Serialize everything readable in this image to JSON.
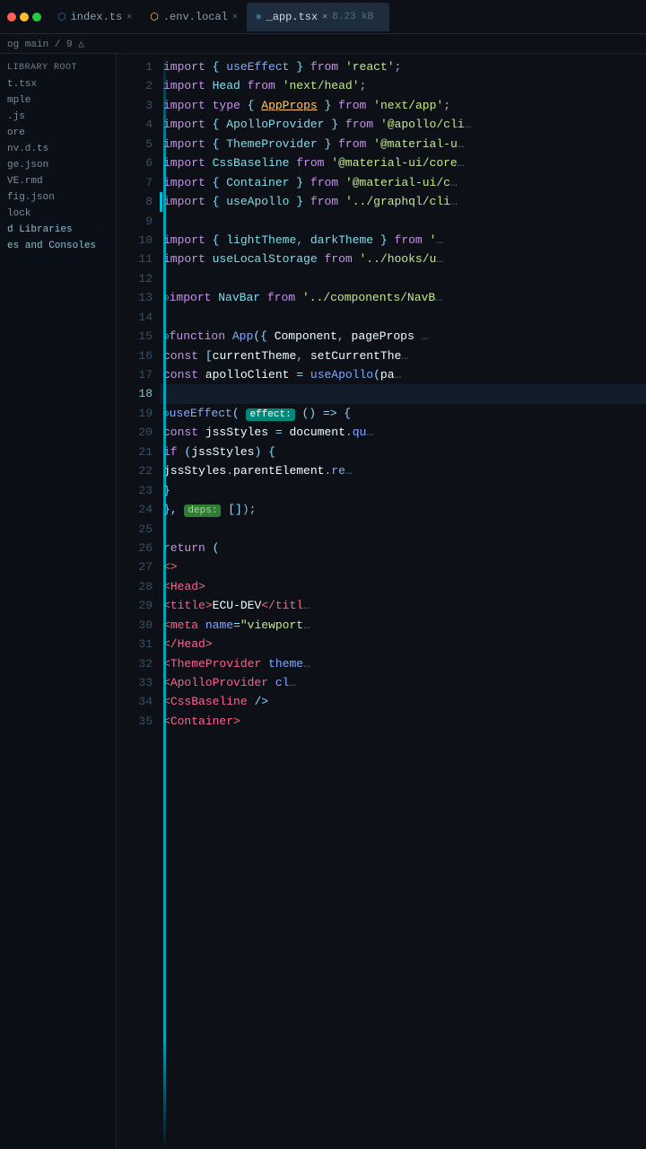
{
  "tabs": [
    {
      "label": "index.ts",
      "icon": "ts",
      "active": false,
      "closable": true
    },
    {
      "label": ".env.local",
      "icon": "env",
      "active": false,
      "closable": true
    },
    {
      "label": "_app.tsx",
      "icon": "react",
      "active": true,
      "closable": true
    }
  ],
  "breadcrumb": "og main / 9 △",
  "file_size": "8.23 kB",
  "sidebar": {
    "header": "library root",
    "items": [
      {
        "label": "t.tsx",
        "type": "file"
      },
      {
        "label": "mple",
        "type": "file"
      },
      {
        "label": ".js",
        "type": "file"
      },
      {
        "label": "ore",
        "type": "file"
      },
      {
        "label": "nv.d.ts",
        "type": "file"
      },
      {
        "label": "ge.json",
        "type": "file"
      },
      {
        "label": "VE.rmd",
        "type": "file"
      },
      {
        "label": "fig.json",
        "type": "file"
      },
      {
        "label": "lock",
        "type": "file"
      },
      {
        "label": "d Libraries",
        "type": "folder"
      },
      {
        "label": "es and Consoles",
        "type": "folder"
      }
    ]
  },
  "lines": [
    {
      "n": 1,
      "code": "import_useEffect_from_react"
    },
    {
      "n": 2,
      "code": "import_Head_from_next_head"
    },
    {
      "n": 3,
      "code": "import_type_AppProps_from_next_app"
    },
    {
      "n": 4,
      "code": "import_ApolloProvider_from_apollo_cli"
    },
    {
      "n": 5,
      "code": "import_ThemeProvider_from_material_u"
    },
    {
      "n": 6,
      "code": "import_CssBaseline_from_material_ui_core"
    },
    {
      "n": 7,
      "code": "import_Container_from_material_ui_c"
    },
    {
      "n": 8,
      "code": "import_useApollo_from_graphql_cli"
    },
    {
      "n": 9,
      "code": "empty"
    },
    {
      "n": 10,
      "code": "import_lightTheme_darkTheme_from"
    },
    {
      "n": 11,
      "code": "import_useLocalStorage_from_hooks_u"
    },
    {
      "n": 12,
      "code": "empty"
    },
    {
      "n": 13,
      "code": "import_NavBar_from_components_NavB"
    },
    {
      "n": 14,
      "code": "empty"
    },
    {
      "n": 15,
      "code": "function_App_Component_pageProps"
    },
    {
      "n": 16,
      "code": "const_currentTheme_setCurrentThe"
    },
    {
      "n": 17,
      "code": "const_apolloClient_useApollo_pa"
    },
    {
      "n": 18,
      "code": "empty_active"
    },
    {
      "n": 19,
      "code": "useEffect_effect_arrow"
    },
    {
      "n": 20,
      "code": "const_jssStyles_document_qu"
    },
    {
      "n": 21,
      "code": "if_jssStyles"
    },
    {
      "n": 22,
      "code": "jssStyles_parentElement_re"
    },
    {
      "n": 23,
      "code": "close_brace"
    },
    {
      "n": 24,
      "code": "close_deps"
    },
    {
      "n": 25,
      "code": "empty"
    },
    {
      "n": 26,
      "code": "return_open"
    },
    {
      "n": 27,
      "code": "fragment_open"
    },
    {
      "n": 28,
      "code": "head_open"
    },
    {
      "n": 29,
      "code": "title_ecu"
    },
    {
      "n": 30,
      "code": "meta_viewport"
    },
    {
      "n": 31,
      "code": "head_close"
    },
    {
      "n": 32,
      "code": "themeprovider_theme"
    },
    {
      "n": 33,
      "code": "apolloprovider_cl"
    },
    {
      "n": 34,
      "code": "cssbaseline"
    },
    {
      "n": 35,
      "code": "container"
    }
  ]
}
